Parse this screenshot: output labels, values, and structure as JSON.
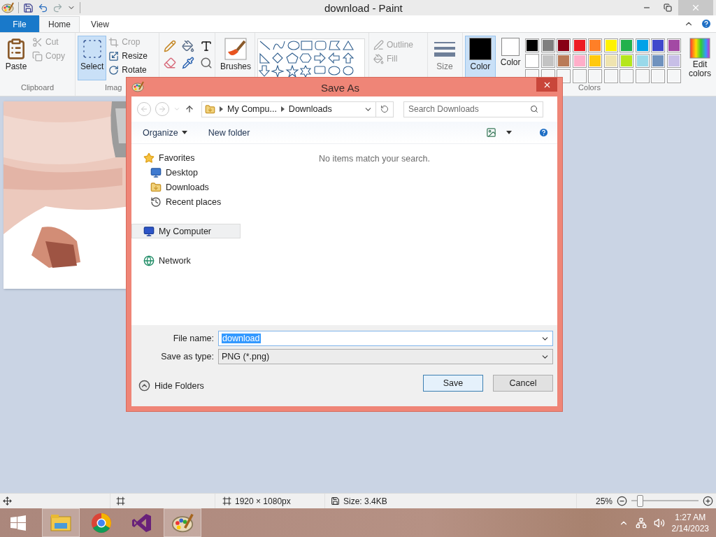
{
  "window": {
    "title": "download - Paint"
  },
  "ribbon_tabs": [
    {
      "label": "File",
      "kind": "file",
      "selected": false
    },
    {
      "label": "Home",
      "kind": "tab",
      "selected": true
    },
    {
      "label": "View",
      "kind": "tab",
      "selected": false
    }
  ],
  "clipboard": {
    "label": "Clipboard",
    "paste": "Paste",
    "items": [
      {
        "label": "Cut",
        "kind": "cut",
        "disabled": true
      },
      {
        "label": "Copy",
        "kind": "copy",
        "disabled": true
      }
    ]
  },
  "image": {
    "label": "Imag",
    "select": {
      "label": "Select",
      "selected": true
    },
    "items": [
      {
        "label": "Crop",
        "kind": "crop",
        "disabled": true
      },
      {
        "label": "Resize",
        "kind": "resize",
        "disabled": false
      },
      {
        "label": "Rotate",
        "kind": "rotate",
        "disabled": false
      }
    ]
  },
  "brushes": "Brushes",
  "shape_styles": [
    {
      "label": "Outline",
      "kind": "outline",
      "disabled": true
    },
    {
      "label": "Fill",
      "kind": "fill",
      "disabled": true
    }
  ],
  "size": "Size",
  "colors": {
    "label": "Colors",
    "current": [
      {
        "label": "Color",
        "color": "#000000",
        "selected": true
      },
      {
        "label": "Color",
        "color": "#ffffff",
        "selected": false
      }
    ],
    "palette": [
      {
        "color": "#000000"
      },
      {
        "color": "#7f7f7f"
      },
      {
        "color": "#880015"
      },
      {
        "color": "#ed1c24"
      },
      {
        "color": "#ff7f27"
      },
      {
        "color": "#fff200"
      },
      {
        "color": "#22b14c"
      },
      {
        "color": "#00a2e8"
      },
      {
        "color": "#3f48cc"
      },
      {
        "color": "#a349a4"
      },
      {
        "color": "#ffffff"
      },
      {
        "color": "#c3c3c3"
      },
      {
        "color": "#b97a57"
      },
      {
        "color": "#ffaec9"
      },
      {
        "color": "#ffc90e"
      },
      {
        "color": "#efe4b0"
      },
      {
        "color": "#b5e61d"
      },
      {
        "color": "#99d9ea"
      },
      {
        "color": "#7092be"
      },
      {
        "color": "#c8bfe7"
      }
    ],
    "edit": "Edit colors"
  },
  "dialog": {
    "title": "Save As",
    "address": [
      "My Compu...",
      "Downloads"
    ],
    "search_placeholder": "Search Downloads",
    "toolbar": [
      "Organize",
      "New folder"
    ],
    "nav": [
      {
        "label": "Favorites",
        "kind": "favorites",
        "selected": false,
        "children": [
          {
            "label": "Desktop",
            "kind": "desktop",
            "selected": false
          },
          {
            "label": "Downloads",
            "kind": "downloads",
            "selected": false
          },
          {
            "label": "Recent places",
            "kind": "recent",
            "selected": false
          }
        ]
      },
      {
        "label": "My Computer",
        "kind": "computer",
        "selected": true
      },
      {
        "label": "Network",
        "kind": "network",
        "selected": false
      }
    ],
    "empty_message": "No items match your search.",
    "file_name": {
      "label": "File name:",
      "value": "download"
    },
    "save_type": {
      "label": "Save as type:",
      "value": "PNG (*.png)"
    },
    "hide_folders": "Hide Folders",
    "buttons": [
      {
        "label": "Save",
        "kind": "default"
      },
      {
        "label": "Cancel",
        "kind": "normal"
      }
    ]
  },
  "status_bar": {
    "dimensions": "1920 × 1080px",
    "size": "Size: 3.4KB",
    "zoom": {
      "reading": "25%",
      "level": 0.08
    }
  },
  "taskbar": {
    "apps": [
      {
        "kind": "explorer",
        "running": true
      },
      {
        "kind": "chrome",
        "running": false
      },
      {
        "kind": "studio",
        "running": false
      },
      {
        "kind": "paint",
        "running": true
      }
    ],
    "time": "1:27 AM",
    "date": "2/14/2023"
  }
}
